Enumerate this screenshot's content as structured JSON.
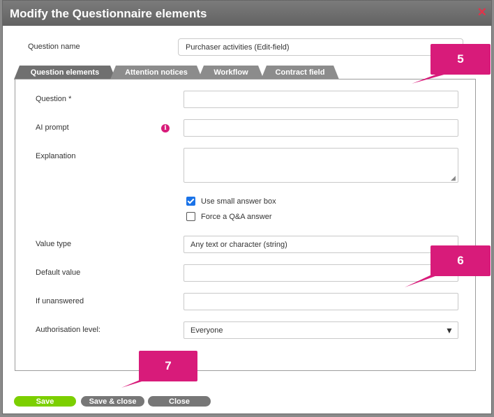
{
  "dialog": {
    "title": "Modify the Questionnaire elements",
    "close_icon": "close-icon"
  },
  "question_name": {
    "label": "Question name",
    "value": "Purchaser activities (Edit-field)"
  },
  "tabs": [
    {
      "label": "Question elements",
      "active": true
    },
    {
      "label": "Attention notices",
      "active": false
    },
    {
      "label": "Workflow",
      "active": false
    },
    {
      "label": "Contract field",
      "active": false
    }
  ],
  "form": {
    "question_label": "Question *",
    "question_value": "",
    "ai_prompt_label": "AI prompt",
    "ai_prompt_value": "",
    "explanation_label": "Explanation",
    "explanation_value": "",
    "small_box_label": "Use small answer box",
    "small_box_checked": true,
    "force_qa_label": "Force a Q&A answer",
    "force_qa_checked": false,
    "value_type_label": "Value type",
    "value_type_value": "Any text or character (string)",
    "default_value_label": "Default value",
    "default_value_value": "",
    "unanswered_label": "If unanswered",
    "unanswered_value": "",
    "authorisation_label": "Authorisation level:",
    "authorisation_value": "Everyone"
  },
  "callouts": {
    "c5": "5",
    "c6": "6",
    "c7": "7"
  },
  "buttons": {
    "save": "Save",
    "save_close": "Save & close",
    "close": "Close"
  },
  "colors": {
    "accent_pink": "#d81b7a",
    "save_green": "#7ccf00",
    "button_gray": "#777777",
    "checkbox_blue": "#1a73e8"
  }
}
